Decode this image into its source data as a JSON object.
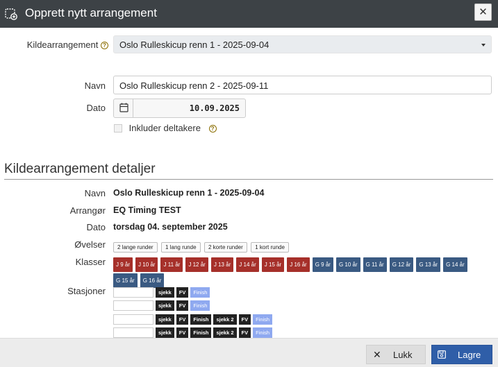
{
  "dialog": {
    "title": "Opprett nytt arrangement",
    "close_glyph": "✕"
  },
  "form": {
    "source_label": "Kildearrangement",
    "source_value": "Oslo Rulleskicup renn 1 - 2025-09-04",
    "name_label": "Navn",
    "name_value": "Oslo Rulleskicup renn 2 - 2025-09-11",
    "date_label": "Dato",
    "date_value": "10.09.2025",
    "include_label": "Inkluder deltakere",
    "include_checked": false
  },
  "details": {
    "title": "Kildearrangement detaljer",
    "name_label": "Navn",
    "name_value": "Oslo Rulleskicup renn 1 - 2025-09-04",
    "organizer_label": "Arrangør",
    "organizer_value": "EQ Timing TEST",
    "date_label": "Dato",
    "date_value": "torsdag 04. september 2025",
    "events_label": "Øvelser",
    "events": [
      "2 lange runder",
      "1 lang runde",
      "2 korte runder",
      "1 kort runde"
    ],
    "classes_label": "Klasser",
    "classes": [
      {
        "label": "J 9 år",
        "color": "#a6302a"
      },
      {
        "label": "J 10 år",
        "color": "#a6302a"
      },
      {
        "label": "J 11 år",
        "color": "#a6302a"
      },
      {
        "label": "J 12 år",
        "color": "#a6302a"
      },
      {
        "label": "J 13 år",
        "color": "#a6302a"
      },
      {
        "label": "J 14 år",
        "color": "#a6302a"
      },
      {
        "label": "J 15 år",
        "color": "#a6302a"
      },
      {
        "label": "J 16 år",
        "color": "#a6302a"
      },
      {
        "label": "G 9 år",
        "color": "#3a5a82"
      },
      {
        "label": "G 10 år",
        "color": "#3a5a82"
      },
      {
        "label": "G 11 år",
        "color": "#3a5a82"
      },
      {
        "label": "G 12 år",
        "color": "#3a5a82"
      },
      {
        "label": "G 13 år",
        "color": "#3a5a82"
      },
      {
        "label": "G 14 år",
        "color": "#3a5a82"
      },
      {
        "label": "G 15 år",
        "color": "#3a5a82"
      },
      {
        "label": "G 16 år",
        "color": "#3a5a82"
      }
    ],
    "stations_label": "Stasjoner",
    "stations": [
      [
        {
          "label": "sjekk",
          "style": "dark"
        },
        {
          "label": "FV",
          "style": "dark"
        },
        {
          "label": "Finish",
          "style": "light"
        }
      ],
      [
        {
          "label": "sjekk",
          "style": "dark"
        },
        {
          "label": "FV",
          "style": "dark"
        },
        {
          "label": "Finish",
          "style": "light"
        }
      ],
      [
        {
          "label": "sjekk",
          "style": "dark"
        },
        {
          "label": "FV",
          "style": "dark"
        },
        {
          "label": "Finish",
          "style": "dark"
        },
        {
          "label": "sjekk 2",
          "style": "dark"
        },
        {
          "label": "FV",
          "style": "dark"
        },
        {
          "label": "Finish",
          "style": "light"
        }
      ],
      [
        {
          "label": "sjekk",
          "style": "dark"
        },
        {
          "label": "FV",
          "style": "dark"
        },
        {
          "label": "Finish",
          "style": "dark"
        },
        {
          "label": "sjekk 2",
          "style": "dark"
        },
        {
          "label": "FV",
          "style": "dark"
        },
        {
          "label": "Finish",
          "style": "light"
        }
      ]
    ]
  },
  "footer": {
    "close_label": "Lukk",
    "save_label": "Lagre"
  }
}
